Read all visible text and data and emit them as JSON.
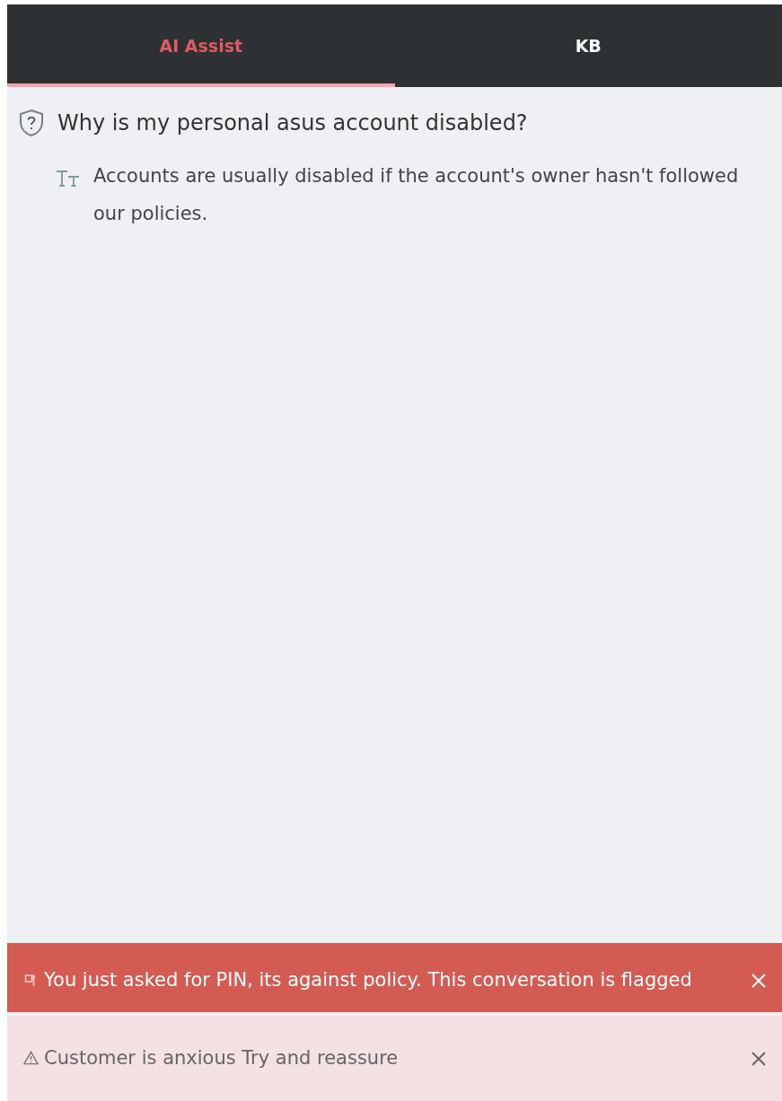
{
  "tabs": [
    {
      "label": "AI Assist",
      "selected": true
    },
    {
      "label": "KB",
      "selected": false
    }
  ],
  "question": "Why is my personal asus account disabled?",
  "answer": "Accounts are usually disabled if the account's owner hasn't followed our policies.",
  "alerts": [
    {
      "kind": "danger",
      "text": "You just asked for PIN, its against policy. This conversation is flagged"
    },
    {
      "kind": "warning",
      "text": "Customer is anxious Try and reassure"
    }
  ]
}
